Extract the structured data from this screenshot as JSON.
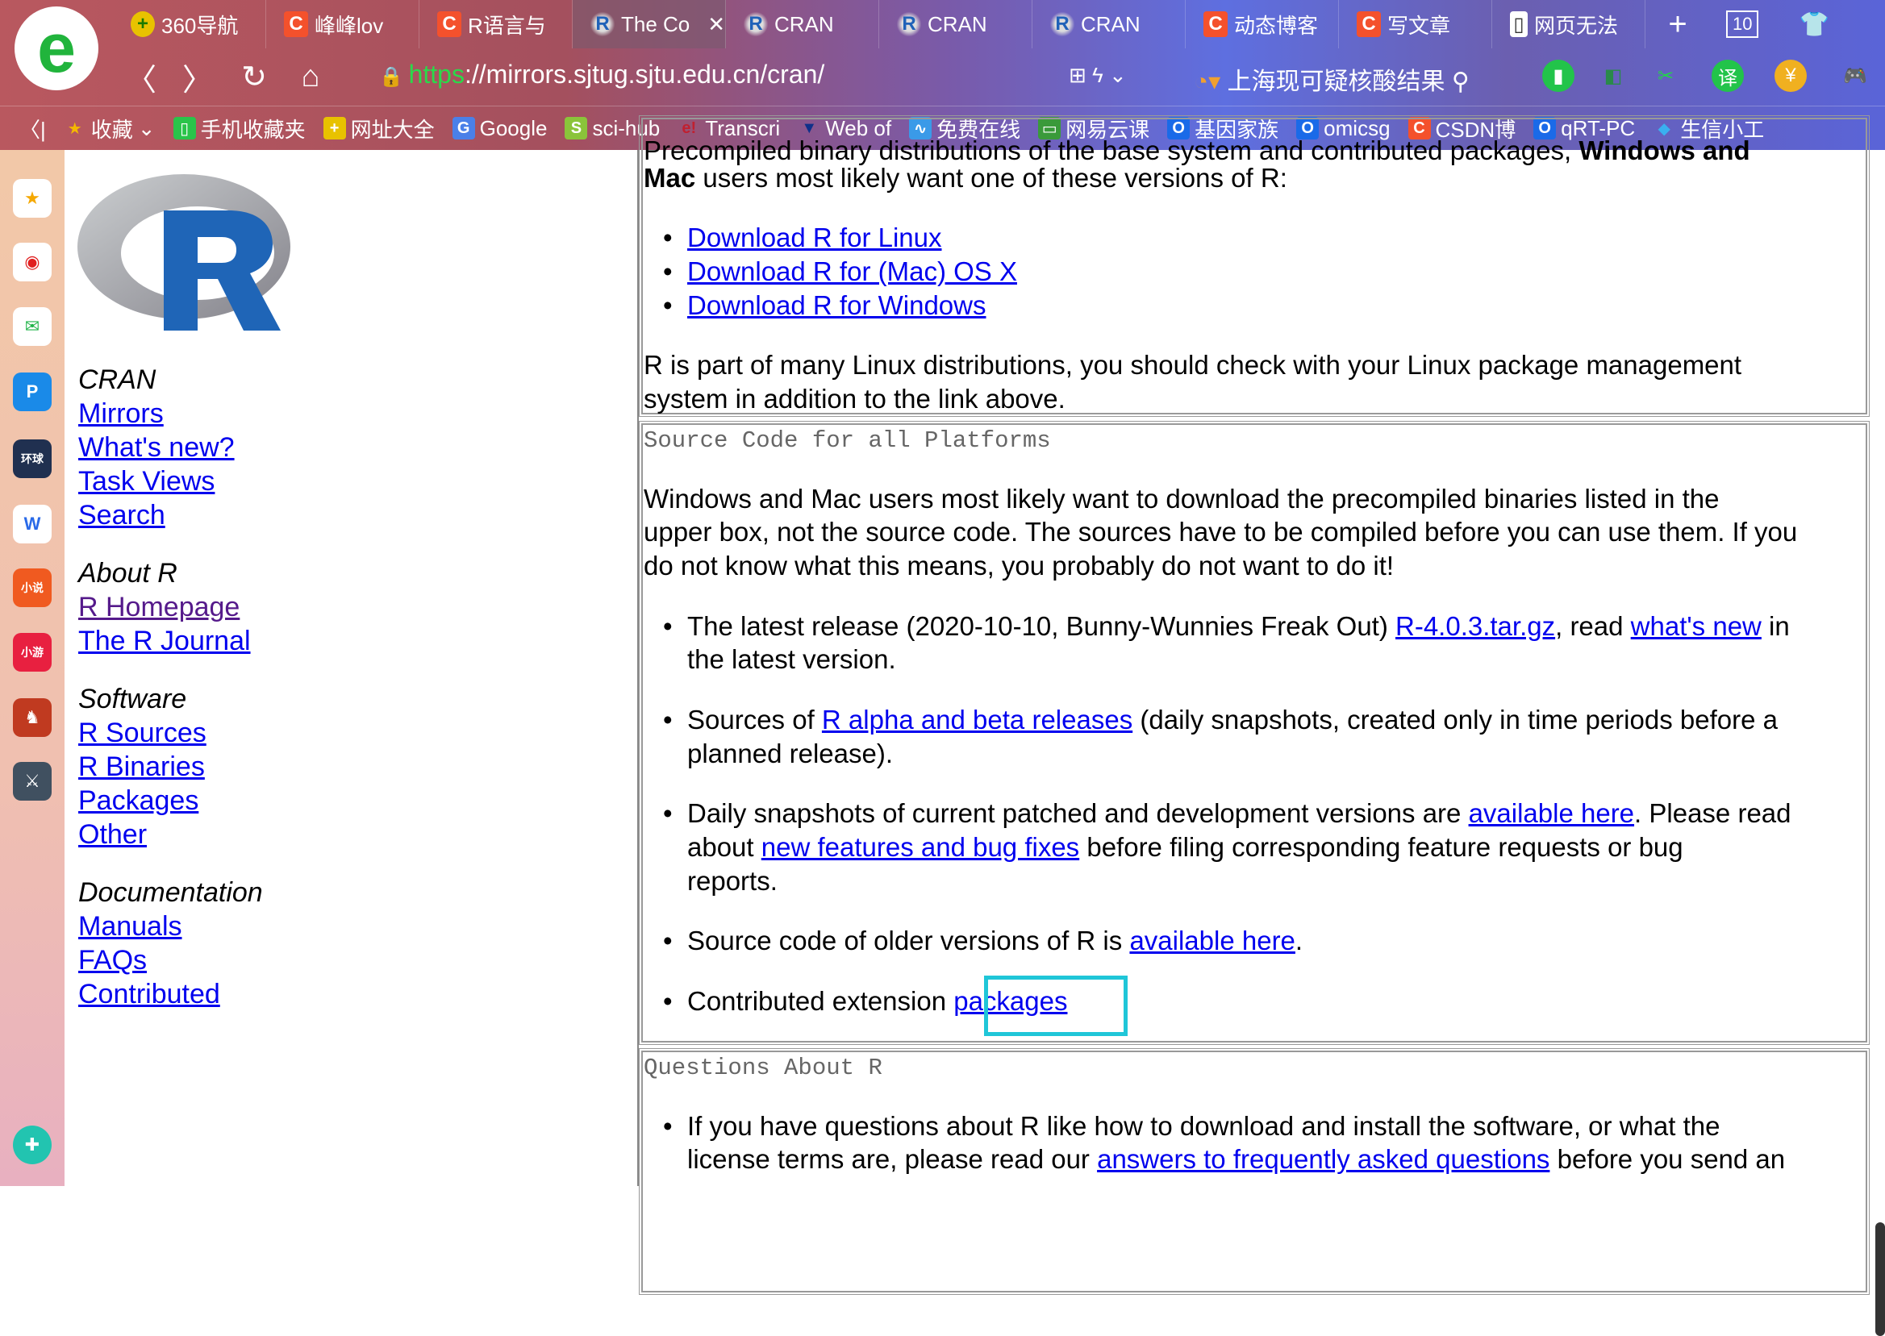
{
  "browser": {
    "tabs": [
      {
        "label": "360导航",
        "icon": "360-icon"
      },
      {
        "label": "峰峰lov",
        "icon": "csdn-icon"
      },
      {
        "label": "R语言与",
        "icon": "csdn-icon"
      },
      {
        "label": "The Co",
        "icon": "r-icon",
        "active": true
      },
      {
        "label": "CRAN",
        "icon": "r-icon"
      },
      {
        "label": "CRAN",
        "icon": "r-icon"
      },
      {
        "label": "CRAN",
        "icon": "r-icon"
      },
      {
        "label": "动态博客",
        "icon": "csdn-icon"
      },
      {
        "label": "写文章",
        "icon": "csdn-icon"
      },
      {
        "label": "网页无法",
        "icon": "file-icon"
      }
    ],
    "tab_count": "10",
    "url_scheme": "https",
    "url_rest": "://mirrors.sjtug.sjtu.edu.cn/cran/",
    "search_text": "上海现可疑核酸结果",
    "bookmarks": [
      "收藏",
      "手机收藏夹",
      "网址大全",
      "Google",
      "sci-hub",
      "Transcri",
      "Web of",
      "免费在线",
      "网易云课",
      "基因家族",
      "omicsg",
      "CSDN博",
      "qRT-PC",
      "生信小工"
    ]
  },
  "leftnav": {
    "sections": [
      {
        "heading": "CRAN",
        "links": [
          "Mirrors",
          "What's new?",
          "Task Views",
          "Search"
        ]
      },
      {
        "heading": "About R",
        "links": [
          "R Homepage",
          "The R Journal"
        ]
      },
      {
        "heading": "Software",
        "links": [
          "R Sources",
          "R Binaries",
          "Packages",
          "Other"
        ]
      },
      {
        "heading": "Documentation",
        "links": [
          "Manuals",
          "FAQs",
          "Contributed"
        ]
      }
    ]
  },
  "main": {
    "top_cut": "Precompiled binary distributions of the base system and contributed packages,",
    "top_cut_bold": "Windows and",
    "mac_bold": "Mac",
    "mac_rest": " users most likely want one of these versions of R:",
    "downloads": [
      "Download R for Linux",
      "Download R for (Mac) OS X",
      "Download R for Windows"
    ],
    "linux_note": [
      "R is part of many Linux distributions, you should check with your Linux package management",
      "system in addition to the link above."
    ],
    "source_title": "Source Code for all Platforms",
    "source_para": [
      "Windows and Mac users most likely want to download the precompiled binaries listed in the",
      "upper box, not the source code. The sources have to be compiled before you can use them. If you",
      "do not know what this means, you probably do not want to do it!"
    ],
    "b1": {
      "t1": "The latest release (2020-10-10, Bunny-Wunnies Freak Out) ",
      "l1": "R-4.0.3.tar.gz",
      "t2": ", read ",
      "l2": "what's new",
      "t3": " in",
      "t4": "the latest version."
    },
    "b2": {
      "t1": "Sources of ",
      "l1": "R alpha and beta releases",
      "t2": " (daily snapshots, created only in time periods before a",
      "t3": "planned release)."
    },
    "b3": {
      "t1": "Daily snapshots of current patched and development versions are ",
      "l1": "available here",
      "t2": ". Please read",
      "t3": "about ",
      "l2": "new features and bug fixes",
      "t4": " before filing corresponding feature requests or bug",
      "t5": "reports."
    },
    "b4": {
      "t1": "Source code of older versions of R is ",
      "l1": "available here",
      "t2": "."
    },
    "b5": {
      "t1": "Contributed extension ",
      "l1": "packages"
    },
    "questions_title": "Questions About R",
    "q1": {
      "t1": "If you have questions about R like how to download and install the software, or what the",
      "t2": "license terms are, please read our ",
      "l1": "answers to frequently asked questions",
      "t3": " before you send an"
    }
  },
  "colors": {
    "link": "#0000ee",
    "visited": "#551a8b",
    "highlight": "#1fc6d8"
  }
}
